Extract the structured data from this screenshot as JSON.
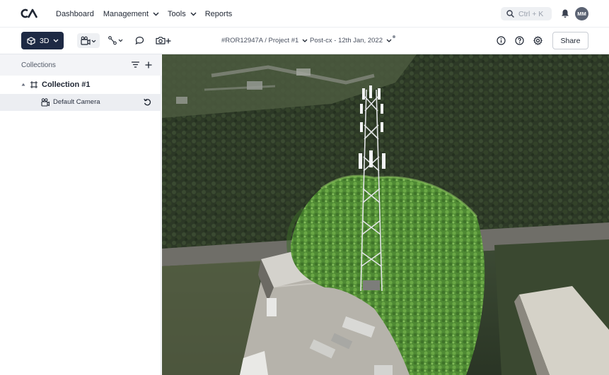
{
  "nav": {
    "items": [
      {
        "label": "Dashboard",
        "has_dropdown": false
      },
      {
        "label": "Management",
        "has_dropdown": true
      },
      {
        "label": "Tools",
        "has_dropdown": true
      },
      {
        "label": "Reports",
        "has_dropdown": false
      }
    ],
    "search_placeholder": "Ctrl + K",
    "avatar_initials": "MM"
  },
  "toolbar": {
    "view_mode_label": "3D",
    "breadcrumb_project": "#ROR12947A / Project #1",
    "breadcrumb_dataset": "Post-cx - 12th Jan, 2022",
    "share_label": "Share",
    "accent_color": "#1e2a44"
  },
  "sidebar": {
    "header_title": "Collections",
    "collection_label": "Collection #1",
    "camera_label": "Default Camera"
  },
  "icons": [
    "logo-icon",
    "chevron-down-icon",
    "search-icon",
    "bell-icon",
    "cube-icon",
    "camera-icon",
    "path-icon",
    "comment-icon",
    "add-photo-icon",
    "info-icon",
    "help-icon",
    "gear-icon",
    "filter-icon",
    "plus-icon",
    "collapse-caret-icon",
    "frame-icon",
    "reset-icon"
  ]
}
